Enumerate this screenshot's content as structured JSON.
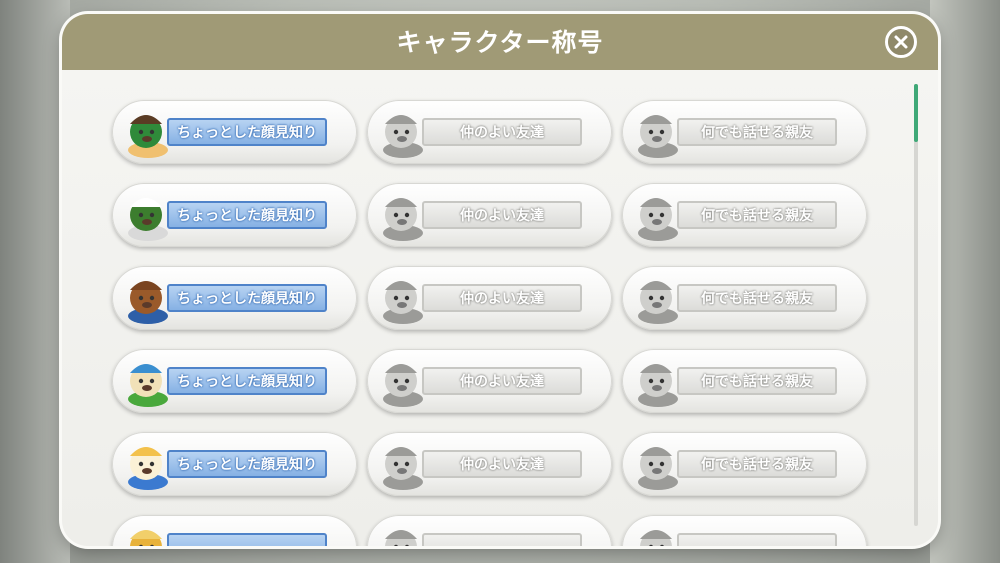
{
  "modal": {
    "title": "キャラクター称号",
    "close_icon": "close-icon"
  },
  "titles": {
    "tier1": "ちょっとした顔見知り",
    "tier2": "仲のよい友達",
    "tier3": "何でも話せる親友"
  },
  "rows": [
    {
      "character": "green-helmet-dog",
      "cards": [
        {
          "label": "ちょっとした顔見知り",
          "state": "unlocked"
        },
        {
          "label": "仲のよい友達",
          "state": "locked"
        },
        {
          "label": "何でも話せる親友",
          "state": "locked"
        }
      ]
    },
    {
      "character": "top-hat-cat",
      "cards": [
        {
          "label": "ちょっとした顔見知り",
          "state": "unlocked"
        },
        {
          "label": "仲のよい友達",
          "state": "locked"
        },
        {
          "label": "何でも話せる親友",
          "state": "locked"
        }
      ]
    },
    {
      "character": "brown-bear",
      "cards": [
        {
          "label": "ちょっとした顔見知り",
          "state": "unlocked"
        },
        {
          "label": "仲のよい友達",
          "state": "locked"
        },
        {
          "label": "何でも話せる親友",
          "state": "locked"
        }
      ]
    },
    {
      "character": "cream-mouse",
      "cards": [
        {
          "label": "ちょっとした顔見知り",
          "state": "unlocked"
        },
        {
          "label": "仲のよい友達",
          "state": "locked"
        },
        {
          "label": "何でも話せる親友",
          "state": "locked"
        }
      ]
    },
    {
      "character": "ribbon-sheep",
      "cards": [
        {
          "label": "ちょっとした顔見知り",
          "state": "unlocked"
        },
        {
          "label": "仲のよい友達",
          "state": "locked"
        },
        {
          "label": "何でも話せる親友",
          "state": "locked"
        }
      ]
    },
    {
      "character": "yellow-character",
      "cards": [
        {
          "label": "",
          "state": "unlocked"
        },
        {
          "label": "",
          "state": "locked"
        },
        {
          "label": "",
          "state": "locked"
        }
      ]
    }
  ],
  "colors": {
    "header": "#a09a76",
    "unlocked_plate": "#86b1e4",
    "locked_plate": "#dcdcd9",
    "scroll_thumb": "#3fa877"
  }
}
